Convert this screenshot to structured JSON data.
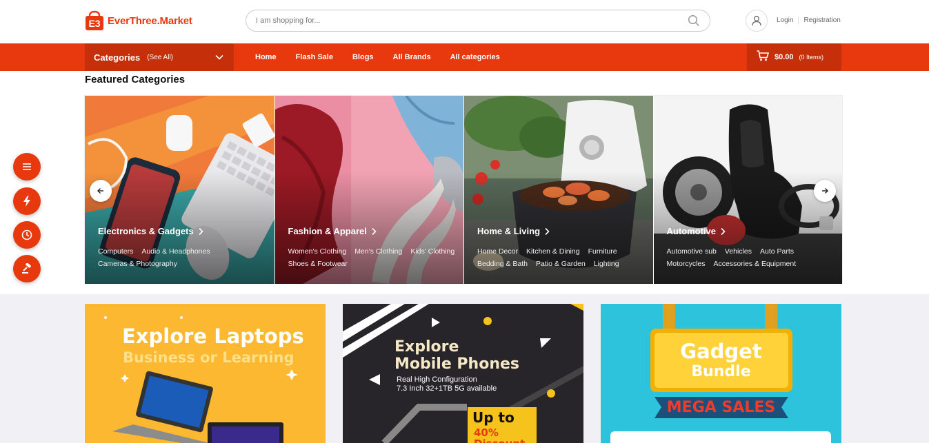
{
  "brand": {
    "name": "EverThree.Market",
    "logo_mark": "E3",
    "accent": "#e8390e",
    "accent_dark": "#c5300a"
  },
  "search": {
    "placeholder": "I am shopping for..."
  },
  "auth": {
    "login": "Login",
    "registration": "Registration"
  },
  "nav": {
    "categories_label": "Categories",
    "see_all": "(See All)",
    "links": [
      "Home",
      "Flash Sale",
      "Blogs",
      "All Brands",
      "All categories"
    ]
  },
  "cart": {
    "amount": "$0.00",
    "items": "(0 Items)"
  },
  "featured": {
    "title": "Featured Categories",
    "cards": [
      {
        "title": "Electronics & Gadgets",
        "subs": [
          "Computers",
          "Audio & Headphones",
          "Cameras & Photography"
        ]
      },
      {
        "title": "Fashion & Apparel",
        "subs": [
          "Women's Clothing",
          "Men's Clothing",
          "Kids' Clothing",
          "Shoes & Footwear"
        ]
      },
      {
        "title": "Home & Living",
        "subs": [
          "Home Decor",
          "Kitchen & Dining",
          "Furniture",
          "Bedding & Bath",
          "Patio & Garden",
          "Lighting"
        ]
      },
      {
        "title": "Automotive",
        "subs": [
          "Automotive sub",
          "Vehicles",
          "Auto Parts",
          "Motorcycles",
          "Accessories & Equipment"
        ]
      }
    ]
  },
  "banners": {
    "laptops": {
      "title": "Explore Laptops",
      "subtitle": "Business or Learning"
    },
    "phones": {
      "title_line1": "Explore",
      "title_line2": "Mobile Phones",
      "spec1": "Real High Configuration",
      "spec2": "7.3 Inch 32+1TB 5G available",
      "offer1": "Up to",
      "offer2": "40%",
      "offer3": "Discount"
    },
    "gadgets": {
      "title1": "Gadget",
      "title2": "Bundle",
      "sale": "MEGA SALES"
    }
  }
}
